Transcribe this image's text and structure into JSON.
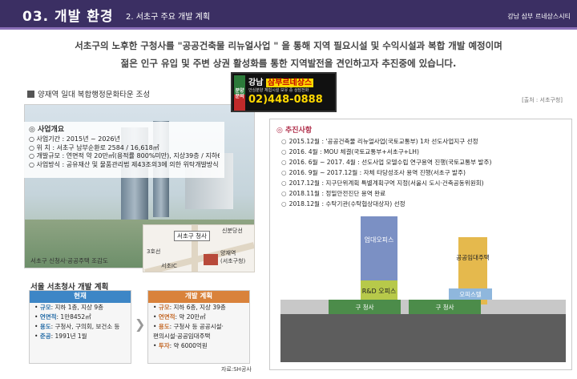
{
  "header": {
    "section_number": "03. 개발 환경",
    "section_sub": "2. 서초구 주요 개발 계획",
    "brand": "강남 삼부 르네상스시티"
  },
  "intro": {
    "line1": "서초구의 노후한 구청사를 \"공공건축물 리뉴얼사업 \" 을 통해 지역 필요시설 및 수익시설과 복합 개발 예정이며",
    "line2": "젊은 인구 유입 및 주변 상권 활성화를 통한 지역발전을 견인하고자 추진중에 있습니다."
  },
  "banner": {
    "tag": "분양문의",
    "name_prefix": "강남",
    "name_highlight": "삼부르네상스",
    "small": "안심분양 체험시설 보유 중 상담전화",
    "phone": "02)448-0888"
  },
  "source_note": "[출처 : 서초구청]",
  "left": {
    "title": "양재역 일대 복합행정문화타운 조성",
    "overview_heading": "◎ 사업개요",
    "overview_rows": [
      "○ 사업기간 : 2015년 ~ 2026년",
      "○ 위      치 : 서초구 남부순환로 2584 / 16,618㎡",
      "○ 개발규모 : 연면적 약 20만㎡(용적률 800%미만), 지상39층 / 지하6층",
      "○ 사업방식 : 공유재산 및 물품관리법 제43조의3에 의한 위탁개발방식"
    ],
    "photo_caption": "서초구 신청사·공공주택 조감도",
    "map": {
      "office": "서초구 청사",
      "line3": "3호선",
      "sinbundang": "신분당선",
      "ic": "서초IC",
      "yangjae": "양재역",
      "yangjae_sub": "(서초구청)"
    },
    "compare_title": "서울 서초청사 개발 계획",
    "current": {
      "head": "현재",
      "items": [
        {
          "k": "규모",
          "v": ": 지하 1층, 지상 9층"
        },
        {
          "k": "연면적",
          "v": ": 1만8452㎡"
        },
        {
          "k": "용도",
          "v": ": 구청사, 구의회, 보건소 등"
        },
        {
          "k": "준공",
          "v": ": 1991년 1월"
        }
      ]
    },
    "plan": {
      "head": "개발 계획",
      "items": [
        {
          "k": "규모",
          "v": ": 지하 6층, 지상 39층"
        },
        {
          "k": "연면적",
          "v": ": 약 20만㎡"
        },
        {
          "k": "용도",
          "v": ": 구청사 등 공공시설·"
        },
        {
          "k": "",
          "v": "  편의시설·공공임대주택"
        },
        {
          "k": "투자",
          "v": ": 약 6000억원"
        }
      ]
    },
    "credit": "자료:SH공사",
    "colors": {
      "current": "#3d86c6",
      "plan": "#d9823b"
    }
  },
  "progress": {
    "heading": "◎ 추진사항",
    "items": [
      "2015.12월 : '공공건축물 리뉴얼사업(국토교통부) 1차 선도사업지구 선정",
      "2016.  4월 : MOU 체결(국토교통부+서초구+LH)",
      "2016.  6월 ~ 2017.  4월 : 선도사업 모델수립 연구용역 진행(국토교통부 발주)",
      "2016.  9월 ~ 2017.12월 : 자체 타당성조사 용역 진행(서초구 발주)",
      "2017.12월 : 지구단위계획 특별계획구역 지정(서울시 도시·건축공동위원회)",
      "2018.11월 : 정밀안전진단 용역 완료",
      "2018.12월 : 수탁기관(수탁협상대상자) 선정"
    ],
    "labels": {
      "office": "업대오피스",
      "housing": "공공임대주택",
      "rnd": "R&D 오피스",
      "office2": "오피스텔",
      "hall": "구 청사",
      "hall2": "구 청사"
    }
  }
}
